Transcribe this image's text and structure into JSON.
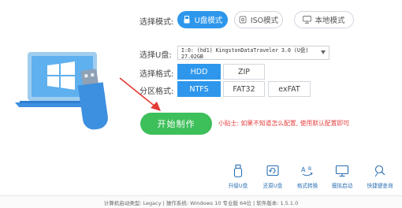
{
  "mode": {
    "label": "选择模式:",
    "options": [
      {
        "label": "U盘模式",
        "icon": "usb-icon"
      },
      {
        "label": "ISO模式",
        "icon": "disc-icon"
      },
      {
        "label": "本地模式",
        "icon": "monitor-icon"
      }
    ],
    "selected": "U盘模式"
  },
  "udisk": {
    "label": "选择U盘:",
    "value": "I:0: (hd1) KingstonDataTraveler 3.0 (U盘) 27.02GB"
  },
  "format": {
    "label": "选择格式:",
    "options": [
      "HDD",
      "ZIP"
    ],
    "selected": "HDD"
  },
  "partition": {
    "label": "分区格式:",
    "options": [
      "NTFS",
      "FAT32",
      "exFAT"
    ],
    "selected": "NTFS"
  },
  "start_button": "开始制作",
  "tip": "小贴士: 如果不知道怎么配置, 使用默认配置即可",
  "tools": [
    {
      "label": "升级U盘",
      "icon": "usb-upgrade-icon"
    },
    {
      "label": "还原U盘",
      "icon": "usb-restore-icon"
    },
    {
      "label": "格式转换",
      "icon": "format-convert-icon"
    },
    {
      "label": "模拟启动",
      "icon": "simulate-boot-icon"
    },
    {
      "label": "快捷键查询",
      "icon": "hotkey-search-icon"
    }
  ],
  "footer": "计算机启动类型: Legacy | 操作系统: Windows 10 专业版 64位 | 软件版本: 1.5.1.0",
  "colors": {
    "accent": "#2e97ec",
    "start": "#3dbf5a",
    "tip": "#e54040",
    "arrow": "#e53935"
  }
}
